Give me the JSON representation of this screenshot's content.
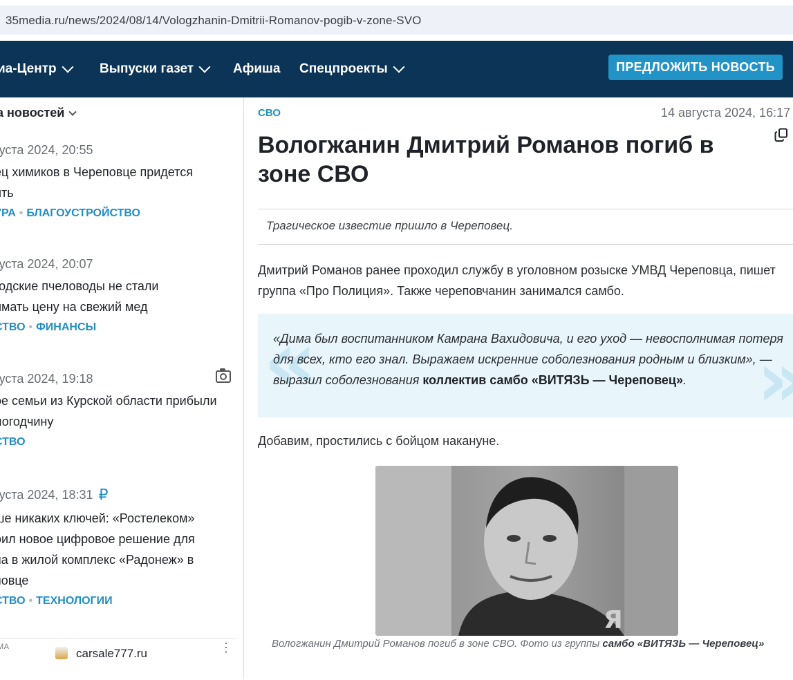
{
  "browser": {
    "url": "35media.ru/news/2024/08/14/Vologzhanin-Dmitrii-Romanov-pogib-v-zone-SVO"
  },
  "nav": {
    "items": [
      {
        "label": "иа-Центр",
        "dropdown": true
      },
      {
        "label": "Выпуски газет",
        "dropdown": true
      },
      {
        "label": "Афиша",
        "dropdown": false
      },
      {
        "label": "Спецпроекты",
        "dropdown": true
      }
    ],
    "suggest_label": "ПРЕДЛОЖИТЬ НОВОСТЬ",
    "bg_color": "#0c3456",
    "accent_color": "#2293c6"
  },
  "feed": {
    "heading": "а новостей",
    "items": [
      {
        "date": "густа 2024, 20:55",
        "title": [
          "ец химиков в Череповце придется",
          "ить"
        ],
        "tags": [
          "УРА",
          "БЛАГОУСТРОЙСТВО"
        ],
        "icon": ""
      },
      {
        "date": "густа 2024, 20:07",
        "title": [
          "годские пчеловоды не стали",
          "имать цену на свежий мед"
        ],
        "tags": [
          "СТВО",
          "ФИНАНСЫ"
        ],
        "icon": ""
      },
      {
        "date": "густа 2024, 19:18",
        "title": [
          "ое семьи из Курской области прибыли",
          "логодчину"
        ],
        "tags": [
          "СТВО"
        ],
        "icon": "camera-icon"
      },
      {
        "date": "густа 2024, 18:31",
        "title": [
          "ше никаких ключей: «Ростелеком»",
          "оил новое цифровое решение для",
          "па в жилой комплекс «Радонеж» в",
          "повце"
        ],
        "tags": [
          "СТВО",
          "ТЕХНОЛОГИИ"
        ],
        "icon": "ruble-icon",
        "rub": "₽"
      }
    ],
    "ad": {
      "label": "МА",
      "site": "carsale777.ru",
      "kebab": "⋮"
    }
  },
  "article": {
    "category": "СВО",
    "date": "14 августа 2024, 16:17",
    "title": "Вологжанин Дмитрий Романов погиб в зоне СВО",
    "lead": "Трагическое известие пришло в Череповец.",
    "paragraph1": "Дмитрий Романов ранее проходил службу в уголовном розыске УМВД Череповца, пишет группа «Про Полиция». Также череповчанин занимался самбо.",
    "quote_text": "«Дима был воспитанником Камрана Вахидовича, и его уход — невосполнимая потеря для всех, кто его знал. Выражаем искренние соболезнования родным и близким», — выразил соболезнования ",
    "quote_bold": "коллектив самбо «ВИТЯЗЬ — Череповец»",
    "quote_end": ".",
    "paragraph2": "Добавим, простились с бойцом накануне.",
    "caption_text": "Вологжанин Дмитрий Романов погиб в зоне СВО. Фото из группы ",
    "caption_bold": "самбо «ВИТЯЗЬ — Череповец»"
  }
}
